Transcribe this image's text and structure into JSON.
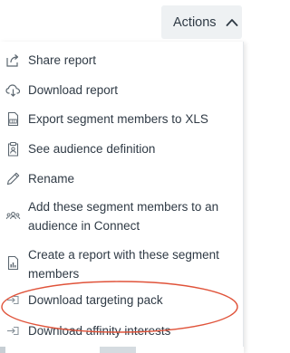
{
  "header": {
    "actions_label": "Actions",
    "actions_icon": "chevron-up-icon"
  },
  "menu": {
    "items": [
      {
        "label": "Share report",
        "icon": "share-icon"
      },
      {
        "label": "Download report",
        "icon": "cloud-download-icon"
      },
      {
        "label": "Export segment members to XLS",
        "icon": "xls-file-icon"
      },
      {
        "label": "See audience definition",
        "icon": "audience-clipboard-icon"
      },
      {
        "label": "Rename",
        "icon": "pencil-icon"
      },
      {
        "label": "Add these segment members to an audience in Connect",
        "icon": "group-icon"
      },
      {
        "label": "Create a report with these segment members",
        "icon": "report-file-icon"
      },
      {
        "label": "Download targeting pack",
        "icon": "download-arrow-icon"
      },
      {
        "label": "Download affinity interests",
        "icon": "download-arrow-icon"
      }
    ]
  },
  "colors": {
    "text": "#2f3a45",
    "button_bg": "#eef1f3",
    "highlight_ellipse": "#e0533a",
    "icon": "#5c6770"
  }
}
